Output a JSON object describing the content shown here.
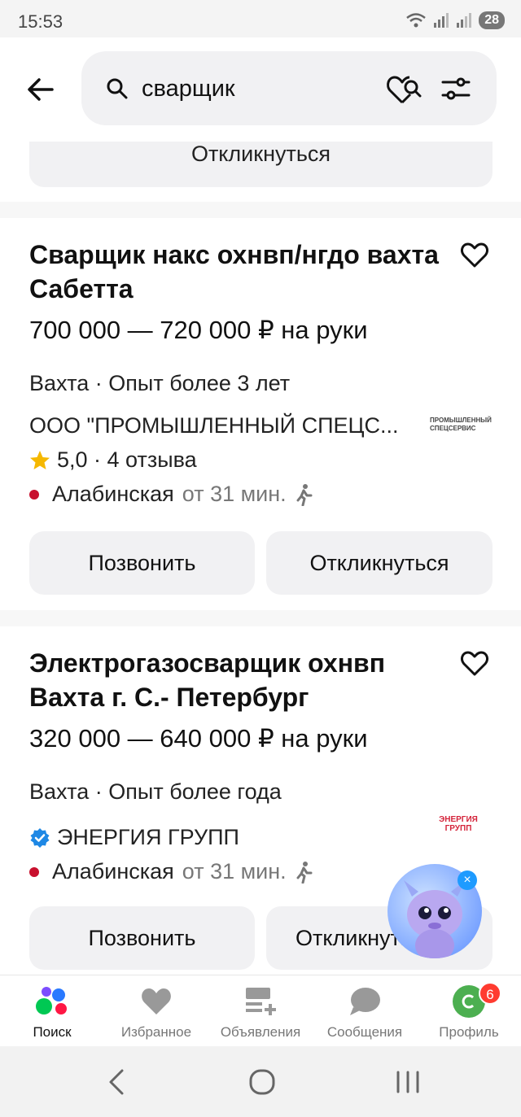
{
  "status_bar": {
    "time": "15:53",
    "battery": "28"
  },
  "search": {
    "query": "сварщик"
  },
  "feed": {
    "previous_card_button": "Откликнуться",
    "cards": [
      {
        "title": "Сварщик накс охнвп/нгдо вахта Сабетта",
        "salary": "700 000 — 720 000 ₽ на руки",
        "meta": "Вахта · Опыт более 3 лет",
        "company": "ООО \"ПРОМЫШЛЕННЫЙ СПЕЦС...",
        "rating": "5,0 · 4 отзыва",
        "metro": "Алабинская",
        "metro_time": "от 31 мин.",
        "logo_text": "ПРОМЫШЛЕННЫЙ СПЕЦСЕРВИС",
        "call_button": "Позвонить",
        "apply_button": "Откликнуться"
      },
      {
        "title": "Электрогазосварщик охнвп Вахта г. С.- Петербург",
        "salary": "320 000 — 640 000 ₽ на руки",
        "meta": "Вахта · Опыт более года",
        "company": "ЭНЕРГИЯ ГРУПП",
        "metro": "Алабинская",
        "metro_time": "от 31 мин.",
        "logo_text": "ЭНЕРГИЯ ГРУПП",
        "call_button": "Позвонить",
        "apply_button": "Откликнуться"
      }
    ]
  },
  "bottom_nav": [
    {
      "label": "Поиск",
      "icon": "search-dots-icon"
    },
    {
      "label": "Избранное",
      "icon": "heart-icon"
    },
    {
      "label": "Объявления",
      "icon": "ads-icon"
    },
    {
      "label": "Сообщения",
      "icon": "chat-icon"
    },
    {
      "label": "Профиль",
      "icon": "profile-icon",
      "badge": "6"
    }
  ],
  "colors": {
    "metro": "#c8102e",
    "star": "#f5b800",
    "verified": "#1e88e5",
    "badge": "#ff3b30"
  }
}
